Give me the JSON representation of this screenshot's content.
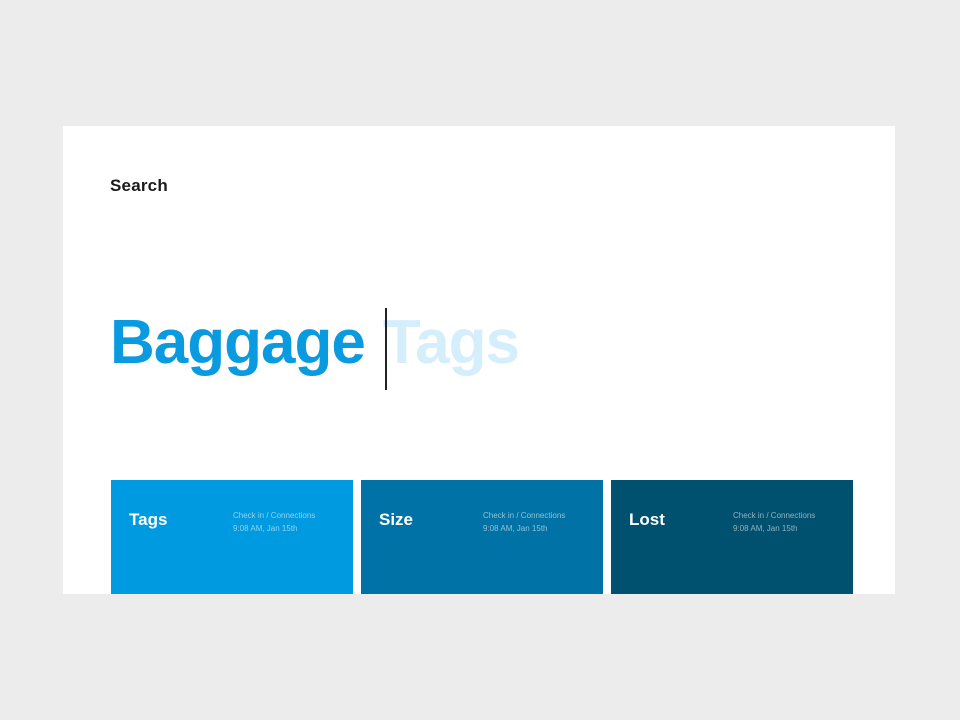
{
  "search": {
    "label": "Search",
    "typed": "Baggage",
    "suggestion": "Tags"
  },
  "colors": {
    "background": "#ececec",
    "card": "#ffffff",
    "accent": "#0a9ae0",
    "suggestion": "#d5eefb",
    "tile_tags": "#009ae1",
    "tile_size": "#0072a6",
    "tile_lost": "#00506f"
  },
  "results": [
    {
      "title": "Tags",
      "category": "Check in / Connections",
      "time": "9:08 AM, Jan 15th"
    },
    {
      "title": "Size",
      "category": "Check in / Connections",
      "time": "9:08 AM, Jan 15th"
    },
    {
      "title": "Lost",
      "category": "Check in / Connections",
      "time": "9:08 AM, Jan 15th"
    }
  ]
}
